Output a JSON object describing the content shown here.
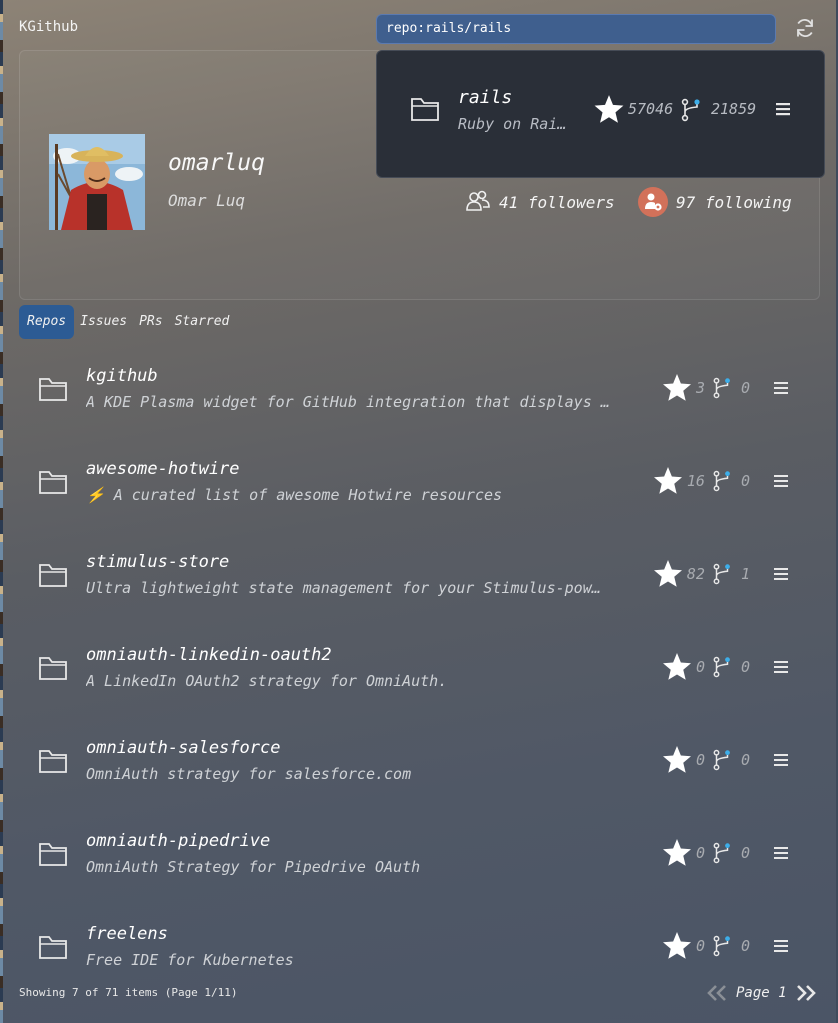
{
  "app": {
    "title": "KGithub",
    "search_value": "repo:rails/rails"
  },
  "profile": {
    "login": "omarluq",
    "name": "Omar Luq",
    "followers_text": "41 followers",
    "following_text": "97 following"
  },
  "popup": {
    "name": "rails",
    "description": "Ruby on Rai…",
    "stars": "57046",
    "forks": "21859"
  },
  "tabs": [
    {
      "label": "Repos",
      "active": true
    },
    {
      "label": "Issues",
      "active": false
    },
    {
      "label": "PRs",
      "active": false
    },
    {
      "label": "Starred",
      "active": false
    }
  ],
  "repos": [
    {
      "name": "kgithub",
      "description": "A KDE Plasma widget for GitHub integration that displays …",
      "stars": "3",
      "forks": "0"
    },
    {
      "name": "awesome-hotwire",
      "description": "⚡ A curated list of awesome Hotwire resources",
      "stars": "16",
      "forks": "0"
    },
    {
      "name": "stimulus-store",
      "description": "Ultra lightweight state management for your Stimulus-pow…",
      "stars": "82",
      "forks": "1"
    },
    {
      "name": "omniauth-linkedin-oauth2",
      "description": "A LinkedIn OAuth2 strategy for OmniAuth.",
      "stars": "0",
      "forks": "0"
    },
    {
      "name": "omniauth-salesforce",
      "description": "OmniAuth strategy for salesforce.com",
      "stars": "0",
      "forks": "0"
    },
    {
      "name": "omniauth-pipedrive",
      "description": "OmniAuth Strategy for Pipedrive OAuth",
      "stars": "0",
      "forks": "0"
    },
    {
      "name": "freelens",
      "description": "Free IDE for Kubernetes",
      "stars": "0",
      "forks": "0"
    }
  ],
  "footer": {
    "status": "Showing 7 of 71 items (Page 1/11)",
    "page_label": "Page 1"
  },
  "colors": {
    "accent": "#2c5b94",
    "search_bg": "#3f5f8e",
    "popup_bg": "#2a2f38",
    "fork_dot": "#3daee9",
    "following_badge": "#d2715a"
  },
  "icons": {
    "refresh": "refresh-icon",
    "folder": "folder-icon",
    "star": "star-icon",
    "fork": "fork-icon",
    "menu": "menu-icon",
    "followers": "followers-icon",
    "following": "following-icon",
    "prev": "prev-page-icon",
    "next": "next-page-icon"
  }
}
